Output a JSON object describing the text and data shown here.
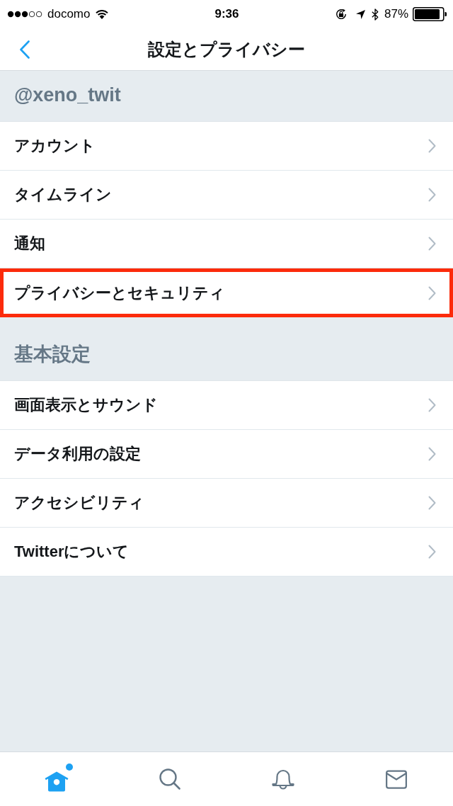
{
  "status_bar": {
    "carrier": "docomo",
    "time": "9:36",
    "battery": "87%"
  },
  "nav": {
    "title": "設定とプライバシー"
  },
  "sections": [
    {
      "header": "@xeno_twit",
      "items": [
        {
          "label": "アカウント",
          "highlighted": false
        },
        {
          "label": "タイムライン",
          "highlighted": false
        },
        {
          "label": "通知",
          "highlighted": false
        },
        {
          "label": "プライバシーとセキュリティ",
          "highlighted": true
        }
      ]
    },
    {
      "header": "基本設定",
      "items": [
        {
          "label": "画面表示とサウンド",
          "highlighted": false
        },
        {
          "label": "データ利用の設定",
          "highlighted": false
        },
        {
          "label": "アクセシビリティ",
          "highlighted": false
        },
        {
          "label": "Twitterについて",
          "highlighted": false
        }
      ]
    }
  ],
  "tab_bar": [
    {
      "kind": "home",
      "selected": true,
      "badge": true
    },
    {
      "kind": "search",
      "selected": false,
      "badge": false
    },
    {
      "kind": "notifications",
      "selected": false,
      "badge": false
    },
    {
      "kind": "messages",
      "selected": false,
      "badge": false
    }
  ]
}
